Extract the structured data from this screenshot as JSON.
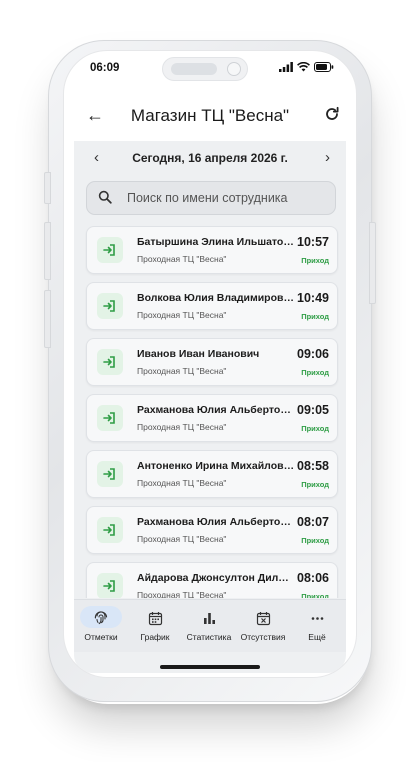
{
  "status_bar": {
    "time": "06:09"
  },
  "header": {
    "title": "Магазин ТЦ \"Весна\""
  },
  "date_nav": {
    "date": "Сегодня, 16 апреля 2026 г."
  },
  "search": {
    "placeholder": "Поиск по имени сотрудника"
  },
  "entries": [
    {
      "name": "Батыршина Элина Ильшатовна",
      "location": "Проходная ТЦ \"Весна\"",
      "time": "10:57",
      "type": "Приход"
    },
    {
      "name": "Волкова Юлия Владимировна",
      "location": "Проходная ТЦ \"Весна\"",
      "time": "10:49",
      "type": "Приход"
    },
    {
      "name": "Иванов Иван Иванович",
      "location": "Проходная ТЦ \"Весна\"",
      "time": "09:06",
      "type": "Приход"
    },
    {
      "name": "Рахманова Юлия Альбертовна",
      "location": "Проходная ТЦ \"Весна\"",
      "time": "09:05",
      "type": "Приход"
    },
    {
      "name": "Антоненко Ирина Михайловна",
      "location": "Проходная ТЦ \"Весна\"",
      "time": "08:58",
      "type": "Приход"
    },
    {
      "name": "Рахманова Юлия Альбертовна",
      "location": "Проходная ТЦ \"Весна\"",
      "time": "08:07",
      "type": "Приход"
    },
    {
      "name": "Айдарова Джонсултон Дилбаровна",
      "location": "Проходная ТЦ \"Весна\"",
      "time": "08:06",
      "type": "Приход"
    }
  ],
  "nav": [
    {
      "label": "Отметки",
      "icon": "fingerprint-icon",
      "active": true
    },
    {
      "label": "График",
      "icon": "calendar-icon",
      "active": false
    },
    {
      "label": "Статистика",
      "icon": "bar-chart-icon",
      "active": false
    },
    {
      "label": "Отсутствия",
      "icon": "calendar-x-icon",
      "active": false
    },
    {
      "label": "Ещё",
      "icon": "more-icon",
      "active": false
    }
  ],
  "colors": {
    "accent_green": "#2e9d45",
    "active_pill": "#d9e6f7",
    "background": "#eef0f2"
  }
}
